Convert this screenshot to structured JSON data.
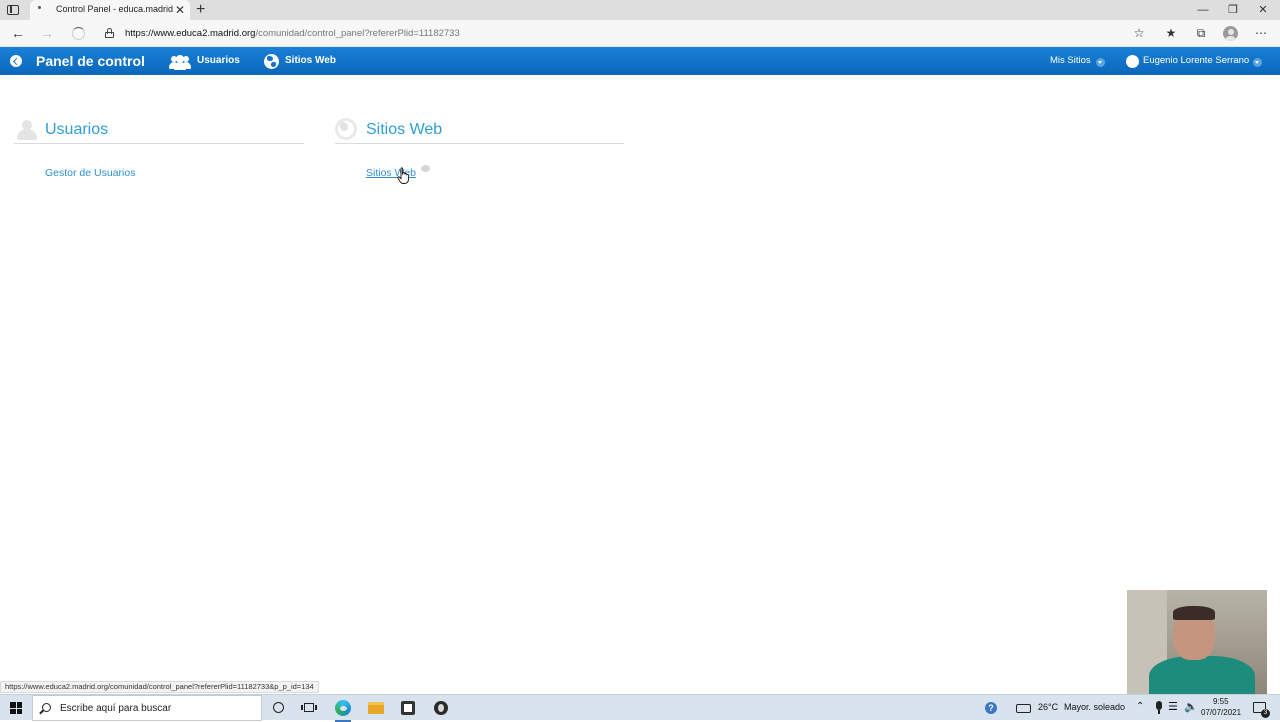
{
  "browser": {
    "tab_title": "Control Panel - educa.madrid.org",
    "tab_close": "✕",
    "new_tab": "+",
    "url_host": "https://www.educa2.madrid.org",
    "url_path": "/comunidad/control_panel?refererPlid=11182733",
    "status_url": "https://www.educa2.madrid.org/comunidad/control_panel?refererPlid=11182733&p_p_id=134",
    "icons": [
      "back-icon",
      "forward-icon",
      "loading-spinner-icon",
      "lock-icon",
      "favorite-add-icon",
      "favorites-icon",
      "collections-icon",
      "profile-icon",
      "more-icon"
    ]
  },
  "dockbar": {
    "title": "Panel de control",
    "usuarios": "Usuarios",
    "sitios_web": "Sitios Web",
    "mis_sitios": "Mis Sitios",
    "user_name": "Eugenio Lorente Serrano"
  },
  "control_panel": {
    "sections": [
      {
        "title": "Usuarios",
        "links": [
          "Gestor de Usuarios"
        ]
      },
      {
        "title": "Sitios Web",
        "links": [
          "Sitios Web"
        ]
      }
    ]
  },
  "taskbar": {
    "search_placeholder": "Escribe aquí para buscar",
    "weather_temp": "26°C",
    "weather_text": "Mayor. soleado",
    "time": "9:55",
    "date": "07/07/2021",
    "notification_count": "3"
  },
  "colors": {
    "dockbar_blue": "#1273cc",
    "section_title": "#2f9ed6",
    "link": "#2f8fd0"
  }
}
